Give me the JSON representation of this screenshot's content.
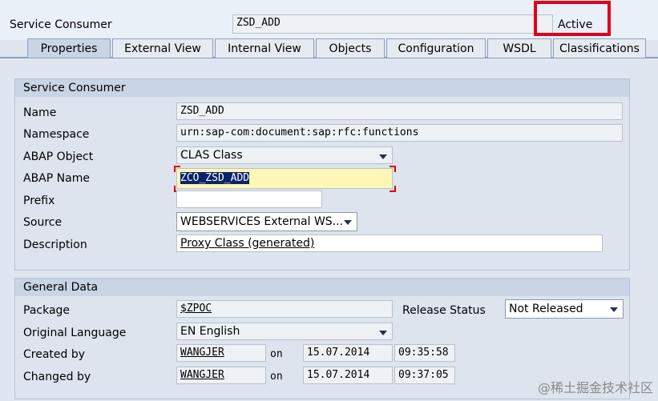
{
  "header": {
    "title_label": "Service Consumer",
    "name_value": "ZSD_ADD",
    "status": "Active"
  },
  "tabs": [
    {
      "label": "Properties",
      "active": true
    },
    {
      "label": "External View",
      "active": false
    },
    {
      "label": "Internal View",
      "active": false
    },
    {
      "label": "Objects",
      "active": false
    },
    {
      "label": "Configuration",
      "active": false
    },
    {
      "label": "WSDL",
      "active": false
    },
    {
      "label": "Classifications",
      "active": false
    }
  ],
  "service_consumer_group": {
    "title": "Service Consumer",
    "name_label": "Name",
    "name_value": "ZSD_ADD",
    "namespace_label": "Namespace",
    "namespace_value": "urn:sap-com:document:sap:rfc:functions",
    "abap_object_label": "ABAP Object",
    "abap_object_value": "CLAS Class",
    "abap_name_label": "ABAP Name",
    "abap_name_value": "ZCO_ZSD_ADD",
    "prefix_label": "Prefix",
    "prefix_value": "",
    "source_label": "Source",
    "source_value": "WEBSERVICES External WS...",
    "description_label": "Description",
    "description_value": "Proxy Class (generated)"
  },
  "general_data_group": {
    "title": "General Data",
    "package_label": "Package",
    "package_value": "$ZPOC",
    "release_status_label": "Release Status",
    "release_status_value": "Not Released",
    "original_language_label": "Original Language",
    "original_language_value": "EN English",
    "created_by_label": "Created by",
    "created_by_user": "WANGJER",
    "created_on_label": "on",
    "created_date": "15.07.2014",
    "created_time": "09:35:58",
    "changed_by_label": "Changed by",
    "changed_by_user": "WANGJER",
    "changed_on_label": "on",
    "changed_date": "15.07.2014",
    "changed_time": "09:37:05"
  },
  "watermark": "@稀土掘金技术社区",
  "colors": {
    "highlight": "#e0001b",
    "selection": "#0a246a",
    "input_highlight": "#fff7b3"
  }
}
